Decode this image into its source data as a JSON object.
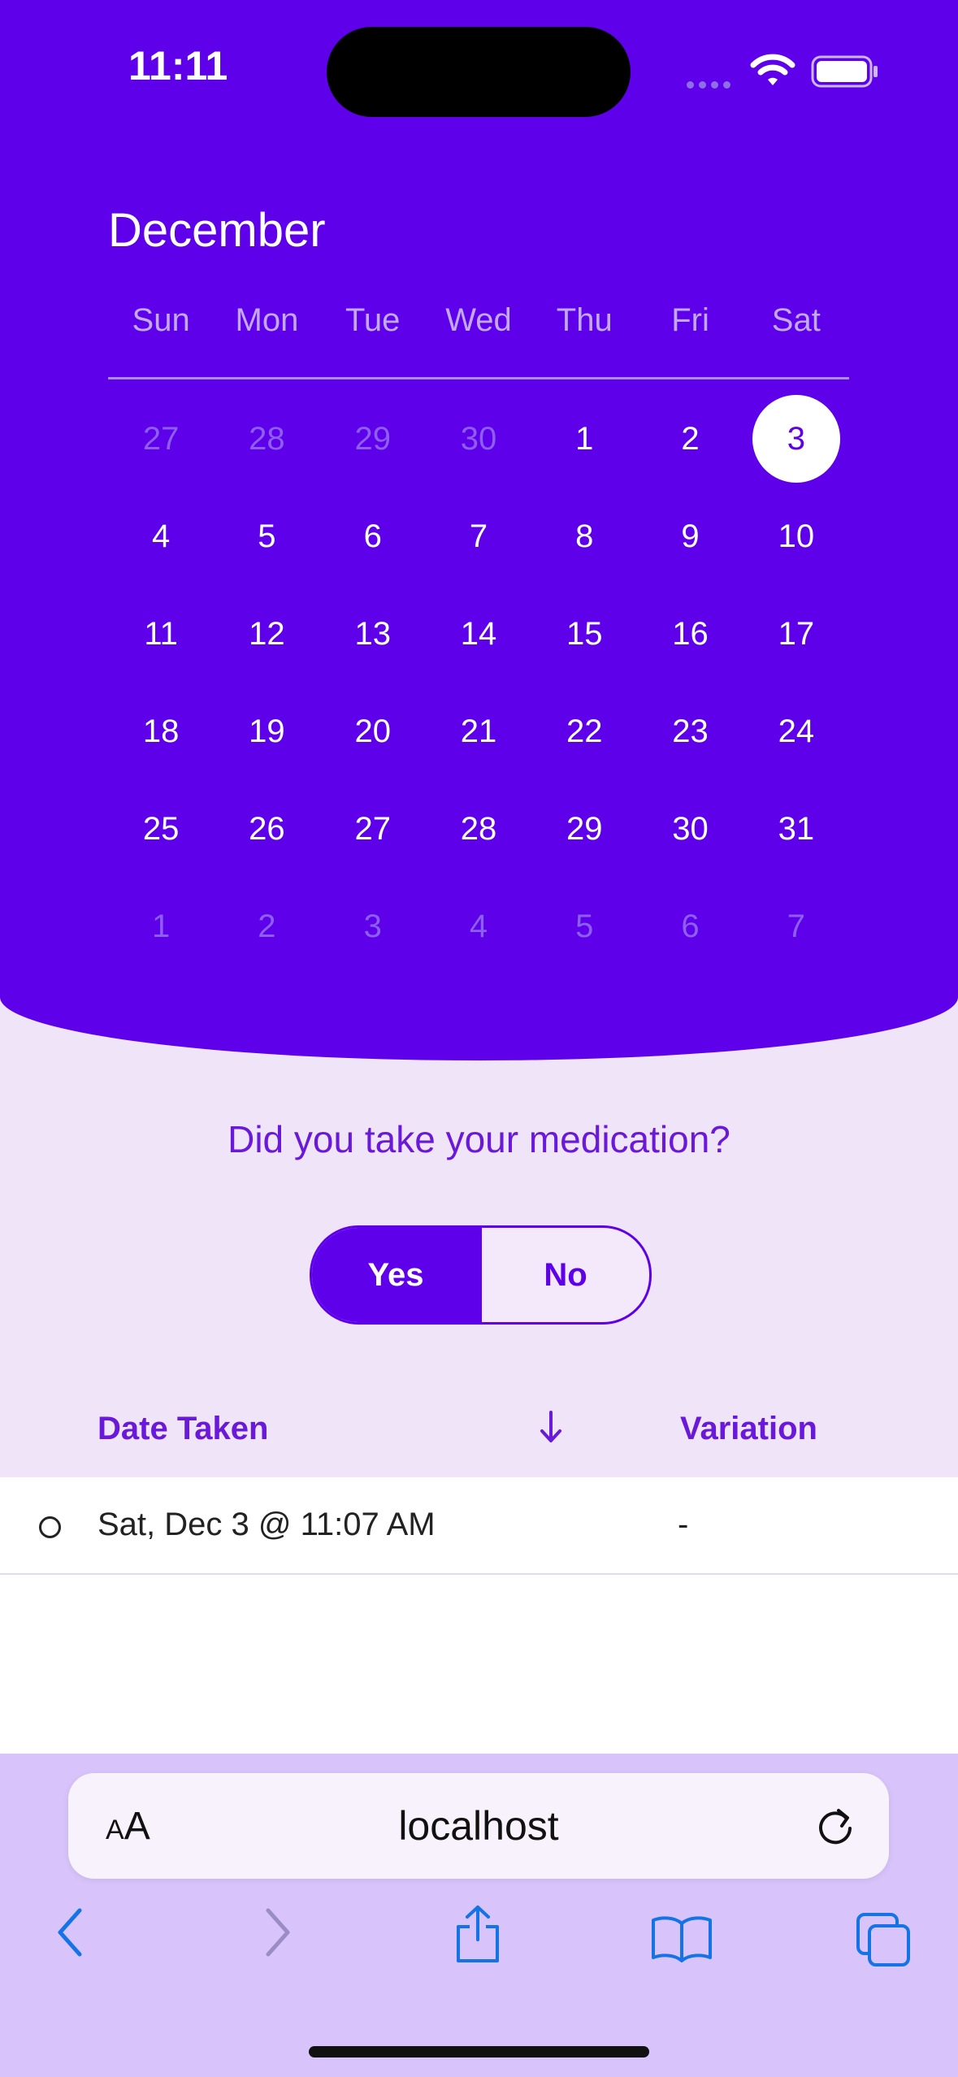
{
  "status_bar": {
    "time": "11:11"
  },
  "calendar": {
    "month": "December",
    "weekdays": [
      "Sun",
      "Mon",
      "Tue",
      "Wed",
      "Thu",
      "Fri",
      "Sat"
    ],
    "weeks": [
      [
        "27",
        "28",
        "29",
        "30",
        "1",
        "2",
        "3"
      ],
      [
        "4",
        "5",
        "6",
        "7",
        "8",
        "9",
        "10"
      ],
      [
        "11",
        "12",
        "13",
        "14",
        "15",
        "16",
        "17"
      ],
      [
        "18",
        "19",
        "20",
        "21",
        "22",
        "23",
        "24"
      ],
      [
        "25",
        "26",
        "27",
        "28",
        "29",
        "30",
        "31"
      ],
      [
        "1",
        "2",
        "3",
        "4",
        "5",
        "6",
        "7"
      ]
    ],
    "selected_day": "3"
  },
  "prompt": {
    "question": "Did you take your medication?",
    "yes_label": "Yes",
    "no_label": "No",
    "selected": "Yes"
  },
  "table": {
    "headers": {
      "date": "Date Taken",
      "sort_icon": "arrow-down-icon",
      "variation": "Variation"
    },
    "rows": [
      {
        "date": "Sat, Dec 3 @ 11:07 AM",
        "variation": "-"
      }
    ]
  },
  "browser": {
    "text_size_label_small": "A",
    "text_size_label_large": "A",
    "url": "localhost"
  },
  "colors": {
    "accent": "#5e00ea",
    "background": "#efe4f8",
    "toolbar": "#d8c4fb"
  }
}
